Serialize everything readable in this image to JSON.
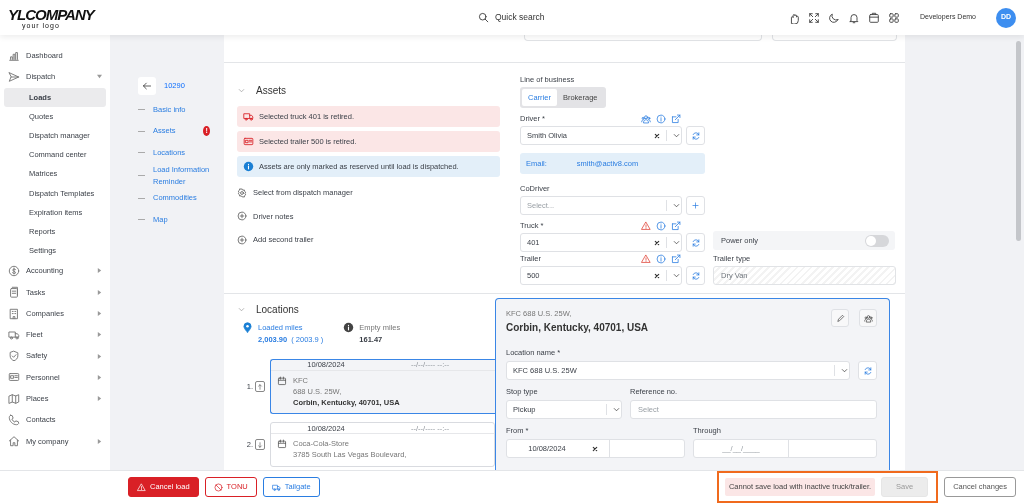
{
  "header": {
    "logo": {
      "mark": "YL",
      "word": "COMPANY",
      "tagline": "your logo"
    },
    "search_label": "Quick search",
    "user_name": "Developers Demo",
    "avatar_initials": "DD"
  },
  "sidebar": {
    "items": [
      {
        "label": "Dashboard",
        "kind": "link"
      },
      {
        "label": "Dispatch",
        "kind": "group",
        "expanded": true,
        "children": [
          {
            "label": "Loads",
            "selected": true
          },
          {
            "label": "Quotes",
            "selected": false
          },
          {
            "label": "Dispatch manager",
            "selected": false
          },
          {
            "label": "Command center",
            "selected": false
          },
          {
            "label": "Matrices",
            "selected": false
          },
          {
            "label": "Dispatch Templates",
            "selected": false
          },
          {
            "label": "Expiration items",
            "selected": false
          },
          {
            "label": "Reports",
            "selected": false
          },
          {
            "label": "Settings",
            "selected": false
          }
        ]
      },
      {
        "label": "Accounting",
        "kind": "group",
        "expanded": false
      },
      {
        "label": "Tasks",
        "kind": "group",
        "expanded": false
      },
      {
        "label": "Companies",
        "kind": "group",
        "expanded": false
      },
      {
        "label": "Fleet",
        "kind": "group",
        "expanded": false
      },
      {
        "label": "Safety",
        "kind": "group",
        "expanded": false
      },
      {
        "label": "Personnel",
        "kind": "group",
        "expanded": false
      },
      {
        "label": "Places",
        "kind": "group",
        "expanded": false
      },
      {
        "label": "Contacts",
        "kind": "link"
      },
      {
        "label": "My company",
        "kind": "group",
        "expanded": false
      }
    ]
  },
  "subnav": {
    "load_number": "10290",
    "items": [
      {
        "label": "Basic info"
      },
      {
        "label": "Assets",
        "badge": "!"
      },
      {
        "label": "Locations"
      },
      {
        "label": "Load Information Reminder"
      },
      {
        "label": "Commodities"
      },
      {
        "label": "Map"
      }
    ]
  },
  "assets": {
    "title": "Assets",
    "expanded": true,
    "alerts": [
      {
        "kind": "truck",
        "text": "Selected truck 401 is retired."
      },
      {
        "kind": "trailer",
        "text": "Selected trailer 500 is retired."
      },
      {
        "kind": "info",
        "text": "Assets are only marked as reserved until load is dispatched."
      }
    ],
    "actions": [
      {
        "kind": "gear",
        "label": "Select from dispatch manager"
      },
      {
        "kind": "plus",
        "label": "Driver notes"
      },
      {
        "kind": "plus",
        "label": "Add second trailer"
      }
    ],
    "line_of_business": {
      "label": "Line of business",
      "options": [
        {
          "label": "Carrier",
          "selected": true
        },
        {
          "label": "Brokerage",
          "selected": false
        }
      ]
    },
    "driver": {
      "label": "Driver *",
      "value": "Smith Olivia",
      "warning": false,
      "tools": true,
      "side_button": {
        "kind": "refresh"
      }
    },
    "email": {
      "label": "Email:",
      "value": "smith@activ8.com"
    },
    "codriver": {
      "label": "CoDriver",
      "placeholder": "Select...",
      "tools": false,
      "side_button": {
        "kind": "add"
      }
    },
    "truck": {
      "label": "Truck *",
      "value": "401",
      "warning": true,
      "tools": true,
      "side_button": {
        "kind": "refresh"
      }
    },
    "power_only": {
      "label": "Power only",
      "on": false
    },
    "trailer": {
      "label": "Trailer",
      "value": "500",
      "warning": true,
      "tools": true,
      "side_button": {
        "kind": "refresh"
      }
    },
    "trailer_type": {
      "label": "Trailer type",
      "value": "Dry Van"
    }
  },
  "locations": {
    "title": "Locations",
    "expanded": true,
    "loaded_miles": {
      "label": "Loaded miles",
      "value": "2,003.90",
      "extra": "( 2003.9 )"
    },
    "empty_miles": {
      "label": "Empty miles",
      "value": "161.47"
    },
    "stops": [
      {
        "number": "1.",
        "kind": "up",
        "date": "10/08/2024",
        "time_placeholder": "--/--/---- --:--",
        "name": "KFC",
        "address": "688 U.S. 25W,",
        "city": "Corbin, Kentucky, 40701, USA",
        "selected": true
      },
      {
        "number": "2.",
        "kind": "down",
        "date": "10/08/2024",
        "time_placeholder": "--/--/---- --:--",
        "name": "Coca-Cola-Store",
        "address": "3785 South Las Vegas Boulevard,",
        "selected": false
      }
    ],
    "detail": {
      "address_line": "KFC 688 U.S. 25W,",
      "title": "Corbin, Kentucky, 40701, USA",
      "location_name": {
        "label": "Location name *",
        "value": "KFC 688 U.S. 25W"
      },
      "stop_type": {
        "label": "Stop type",
        "value": "Pickup"
      },
      "reference": {
        "label": "Reference no.",
        "placeholder": "Select"
      },
      "from": {
        "label": "From *",
        "value": "10/08/2024"
      },
      "through": {
        "label": "Through",
        "placeholder": "__/__/____"
      }
    }
  },
  "footer": {
    "buttons": [
      {
        "label": "Cancel load",
        "kind": "danger"
      },
      {
        "label": "TONU",
        "kind": "outline-danger"
      },
      {
        "label": "Tailgate",
        "kind": "outline-primary"
      }
    ],
    "warning": "Cannot save load with inactive truck/trailer.",
    "highlighted": true,
    "save": {
      "label": "Save",
      "disabled": true
    },
    "cancel": {
      "label": "Cancel changes"
    }
  }
}
